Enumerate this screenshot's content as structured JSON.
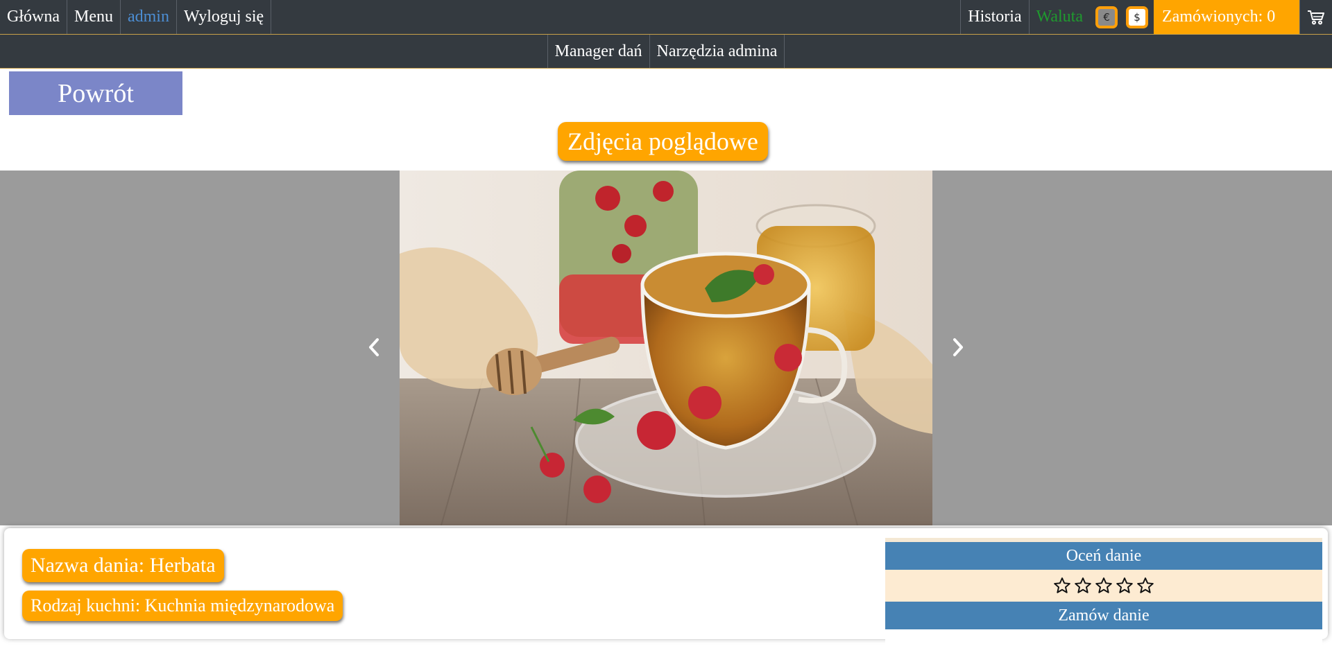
{
  "nav": {
    "home": "Główna",
    "menu": "Menu",
    "user": "admin",
    "logout": "Wyloguj się",
    "history": "Historia",
    "currency_label": "Waluta",
    "currency_euro": "€",
    "currency_dollar": "$",
    "orders": "Zamówionych: 0"
  },
  "subnav": {
    "dish_manager": "Manager dań",
    "admin_tools": "Narzędzia admina"
  },
  "back_button": "Powrót",
  "gallery": {
    "title": "Zdjęcia poglądowe"
  },
  "dish": {
    "name": "Nazwa dania: Herbata",
    "cuisine": "Rodzaj kuchni: Kuchnia międzynarodowa"
  },
  "rating_panel": {
    "rate_header": "Oceń danie",
    "rating_value": 0,
    "rating_max": 5,
    "order_header": "Zamów danie"
  },
  "colors": {
    "navbar": "#343a40",
    "accent_orange": "#ffa500",
    "back_button": "#7b86c8",
    "panel_blue": "#4682b4",
    "panel_cream": "#fdebd2",
    "currency_label": "#1f9a2e",
    "user_link": "#4c8ed4"
  }
}
